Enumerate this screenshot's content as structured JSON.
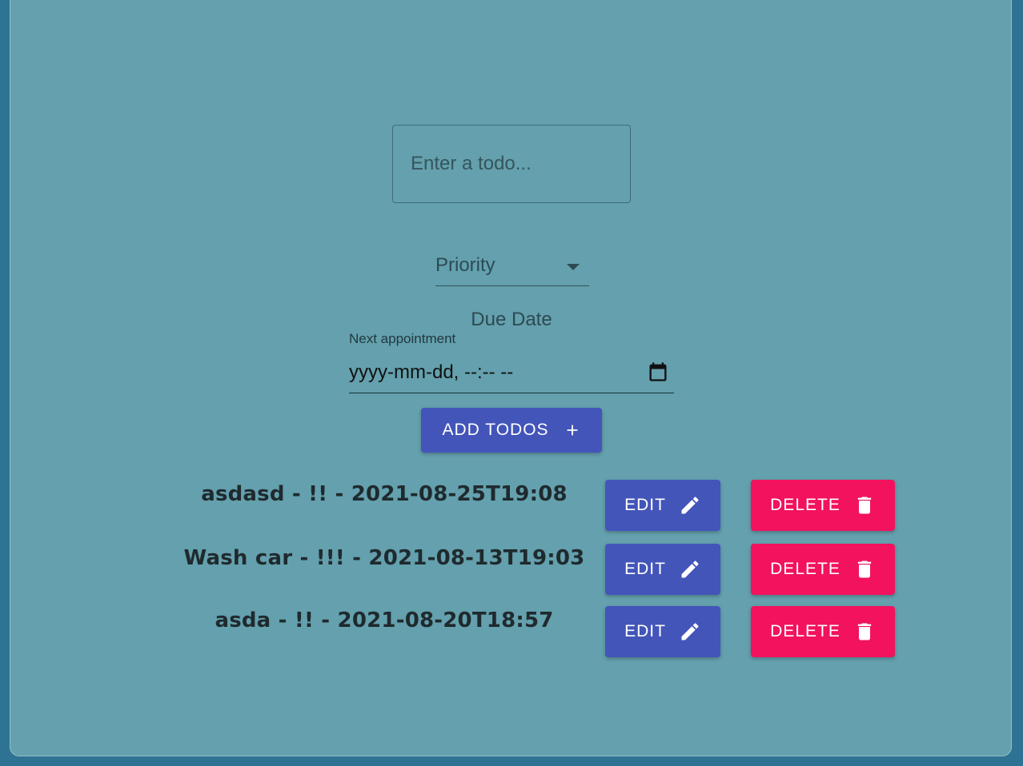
{
  "form": {
    "todo_placeholder": "Enter a todo...",
    "priority_label": "Priority",
    "due_date_heading": "Due Date",
    "appointment_label": "Next appointment",
    "date_placeholder": "yyyy-mm-dd, --:-- --",
    "add_button_label": "ADD TODOS"
  },
  "todos": [
    {
      "text": "asdasd - !! - 2021-08-25T19:08",
      "edit_label": "EDIT",
      "delete_label": "DELETE"
    },
    {
      "text": "Wash car - !!! - 2021-08-13T19:03",
      "edit_label": "EDIT",
      "delete_label": "DELETE"
    },
    {
      "text": "asda - !! - 2021-08-20T18:57",
      "edit_label": "EDIT",
      "delete_label": "DELETE"
    }
  ],
  "icons": {
    "add": "plus-icon",
    "edit": "pencil-icon",
    "delete": "trash-icon",
    "date": "calendar-icon",
    "select": "caret-down-icon"
  },
  "colors": {
    "background": "#2f7394",
    "card": "#64a0ad",
    "primary": "#4355b9",
    "danger": "#f2125e"
  }
}
